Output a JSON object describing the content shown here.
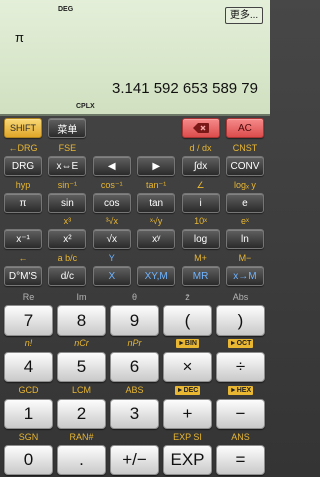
{
  "display": {
    "angle_mode": "DEG",
    "more_button": "更多...",
    "expression": "π",
    "result": "3.141 592 653 589 79",
    "mode_flag": "CPLX"
  },
  "top_row": {
    "shift": "SHIFT",
    "menu": "菜单",
    "backspace_icon": "backspace-icon",
    "ac": "AC"
  },
  "func_rows": [
    {
      "labels": [
        "←DRG",
        "FSE",
        "",
        "",
        "d / dx",
        "CNST"
      ],
      "keys": [
        "DRG",
        "x⇔E",
        "◀",
        "▶",
        "∫dx",
        "CONV"
      ]
    },
    {
      "labels": [
        "hyp",
        "sin⁻¹",
        "cos⁻¹",
        "tan⁻¹",
        "∠",
        "logₓ y"
      ],
      "keys": [
        "π",
        "sin",
        "cos",
        "tan",
        "i",
        "e"
      ]
    },
    {
      "labels": [
        "",
        "x³",
        "³√x",
        "ˣ√y",
        "10ˣ",
        "eˣ"
      ],
      "keys": [
        "x⁻¹",
        "x²",
        "√x",
        "xʸ",
        "log",
        "ln"
      ]
    },
    {
      "labels": [
        "←",
        "a b/c",
        "Y",
        "",
        "M+",
        "M−"
      ],
      "keys": [
        "D°M'S",
        "d/c",
        "X",
        "XY,M",
        "MR",
        "x→M"
      ]
    }
  ],
  "num_rows": [
    {
      "labels": [
        "Re",
        "Im",
        "θ",
        "z̄",
        "Abs"
      ],
      "keys": [
        "7",
        "8",
        "9",
        "(",
        ")"
      ]
    },
    {
      "labels": [
        "n!",
        "nCr",
        "nPr",
        "►BIN",
        "►OCT"
      ],
      "keys": [
        "4",
        "5",
        "6",
        "×",
        "÷"
      ]
    },
    {
      "labels": [
        "GCD",
        "LCM",
        "ABS",
        "►DEC",
        "►HEX"
      ],
      "keys": [
        "1",
        "2",
        "3",
        "+",
        "−"
      ]
    },
    {
      "labels": [
        "SGN",
        "RAN#",
        "",
        "EXP SI",
        "ANS"
      ],
      "keys": [
        "0",
        ".",
        "+/−",
        "EXP",
        "="
      ]
    }
  ],
  "colors": {
    "lcd_background": "#dbe8cd",
    "shift_key": "#f0c14b",
    "shifted_label": "#e9b732",
    "clear_keys": "#ec6a6a",
    "memory_text": "#6fb4ff",
    "complex_label": "#b4b4b4"
  }
}
